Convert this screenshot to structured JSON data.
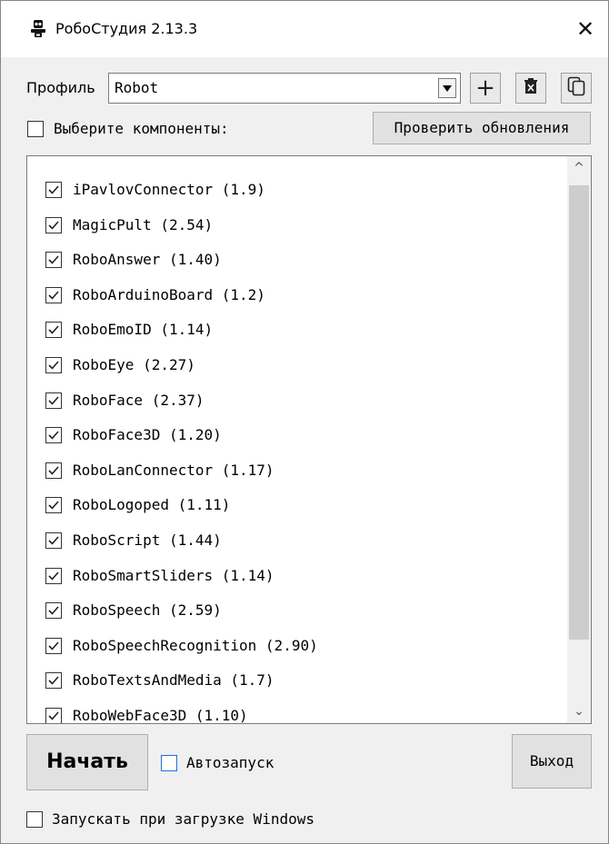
{
  "window": {
    "title": "РобоСтудия 2.13.3",
    "icon": "robot-icon",
    "close_icon": "close-icon",
    "close_glyph": "✕"
  },
  "profile": {
    "label": "Профиль",
    "selected": "Robot",
    "add_icon": "plus-icon",
    "add_glyph": "+",
    "delete_icon": "delete-icon",
    "copy_icon": "copy-icon"
  },
  "components": {
    "select_all_label": "Выберите компоненты:",
    "select_all_checked": false,
    "check_updates_label": "Проверить обновления",
    "items": [
      {
        "label": "iPavlovConnector (1.9)",
        "checked": true
      },
      {
        "label": "MagicPult (2.54)",
        "checked": true
      },
      {
        "label": "RoboAnswer (1.40)",
        "checked": true
      },
      {
        "label": "RoboArduinoBoard (1.2)",
        "checked": true
      },
      {
        "label": "RoboEmoID (1.14)",
        "checked": true
      },
      {
        "label": "RoboEye (2.27)",
        "checked": true
      },
      {
        "label": "RoboFace (2.37)",
        "checked": true
      },
      {
        "label": "RoboFace3D (1.20)",
        "checked": true
      },
      {
        "label": "RoboLanConnector (1.17)",
        "checked": true
      },
      {
        "label": "RoboLogoped (1.11)",
        "checked": true
      },
      {
        "label": "RoboScript (1.44)",
        "checked": true
      },
      {
        "label": "RoboSmartSliders (1.14)",
        "checked": true
      },
      {
        "label": "RoboSpeech (2.59)",
        "checked": true
      },
      {
        "label": "RoboSpeechRecognition (2.90)",
        "checked": true
      },
      {
        "label": "RoboTextsAndMedia (1.7)",
        "checked": true
      },
      {
        "label": "RoboWebFace3D (1.10)",
        "checked": true
      }
    ],
    "scroll_up_glyph": "^",
    "scroll_down_glyph": "⌄"
  },
  "actions": {
    "start_label": "Начать",
    "autostart_label": "Автозапуск",
    "autostart_checked": false,
    "exit_label": "Выход",
    "run_on_windows_start_label": "Запускать при загрузке Windows",
    "run_on_windows_start_checked": false
  },
  "colors": {
    "window_bg": "#f0f0f0",
    "titlebar_bg": "#ffffff",
    "button_bg": "#e1e1e1",
    "accent_checkbox": "#1a73d8"
  }
}
